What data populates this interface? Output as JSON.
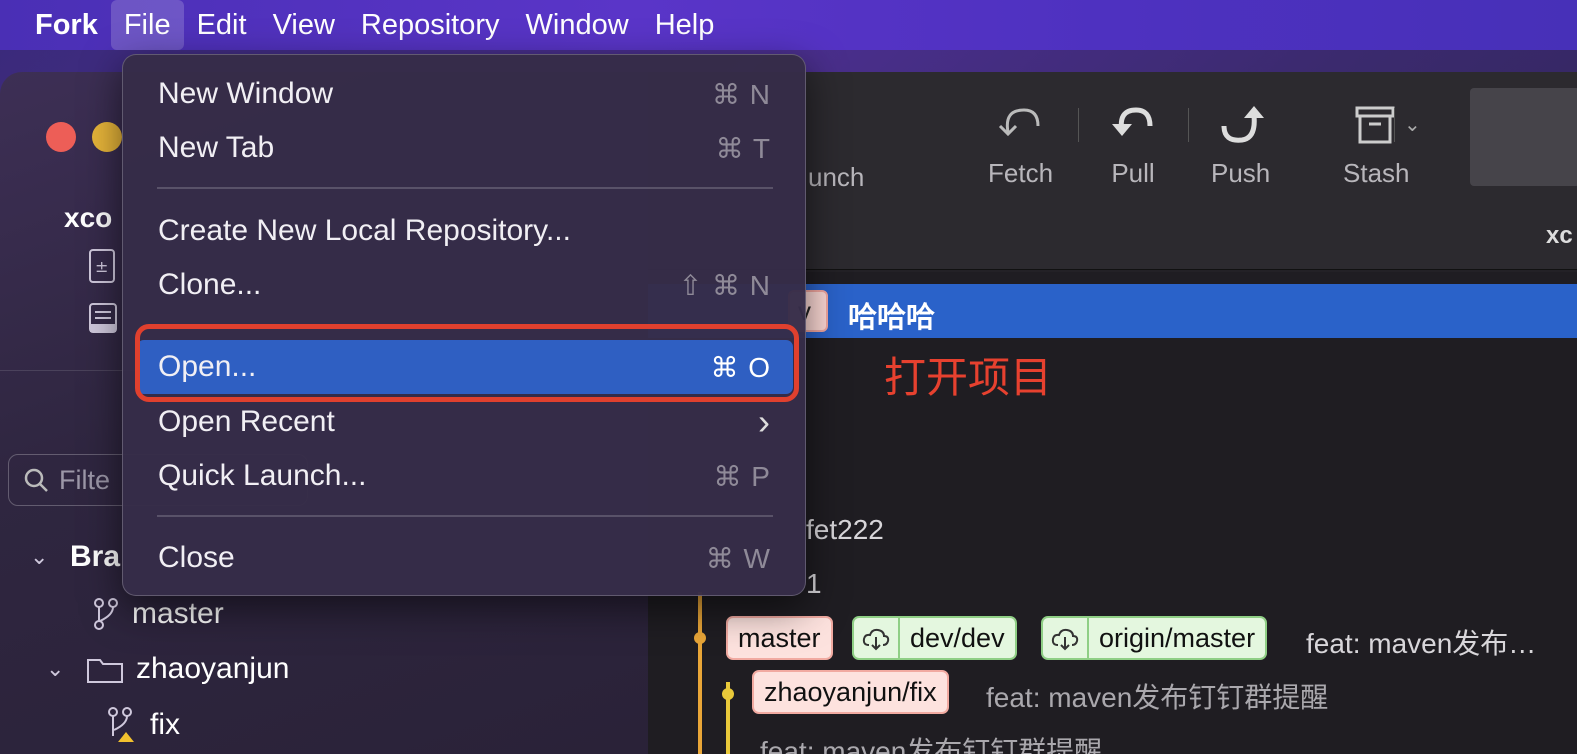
{
  "menubar": {
    "items": [
      "Fork",
      "File",
      "Edit",
      "View",
      "Repository",
      "Window",
      "Help"
    ]
  },
  "sidebar": {
    "repo_name": "xco",
    "filter_placeholder": "Filte",
    "branches_header": "Bra",
    "branch_master": "master",
    "folder": "zhaoyanjun",
    "branch_fix": "fix"
  },
  "toolbar": {
    "partial_label": "unch",
    "fetch": "Fetch",
    "pull": "Pull",
    "push": "Push",
    "stash": "Stash",
    "repo_partial": "xc"
  },
  "commits": {
    "selected_tag": "v",
    "selected_message": "哈哈哈",
    "annotation": "打开项目",
    "row_fet": "fet222",
    "row_one": "1",
    "tag_master": "master",
    "tag_dev": "dev/dev",
    "tag_origin": "origin/master",
    "msg_master": "feat: maven发布…",
    "tag_fix": "zhaoyanjun/fix",
    "msg_fix": "feat: maven发布钉钉群提醒",
    "msg_last": "feat: maven发布钉钉群提醒"
  },
  "file_menu": {
    "new_window": {
      "label": "New Window",
      "shortcut": "⌘ N"
    },
    "new_tab": {
      "label": "New Tab",
      "shortcut": "⌘ T"
    },
    "create_local": {
      "label": "Create New Local Repository..."
    },
    "clone": {
      "label": "Clone...",
      "shortcut": "⇧ ⌘ N"
    },
    "open": {
      "label": "Open...",
      "shortcut": "⌘ O"
    },
    "open_recent": {
      "label": "Open Recent",
      "shortcut": "›"
    },
    "quick_launch": {
      "label": "Quick Launch...",
      "shortcut": "⌘ P"
    },
    "close": {
      "label": "Close",
      "shortcut": "⌘ W"
    }
  },
  "colors": {
    "accent_highlight": "#2f5fc2",
    "annotation_red": "#e0402e"
  }
}
